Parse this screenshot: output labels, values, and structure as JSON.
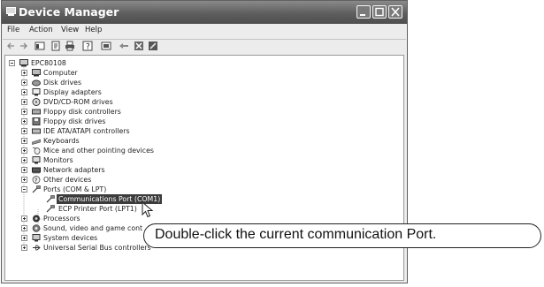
{
  "window": {
    "title": "Device Manager",
    "menu": [
      "File",
      "Action",
      "View",
      "Help"
    ]
  },
  "toolbar": {
    "icons": [
      "back-icon",
      "forward-icon",
      "view-icon",
      "properties-icon",
      "print-icon",
      "help-icon",
      "scan-icon",
      "update-driver-icon",
      "uninstall-icon",
      "disable-icon"
    ]
  },
  "tree": {
    "root": "EPC80108",
    "items": [
      {
        "label": "Computer",
        "expanded": false
      },
      {
        "label": "Disk drives",
        "expanded": false
      },
      {
        "label": "Display adapters",
        "expanded": false
      },
      {
        "label": "DVD/CD-ROM drives",
        "expanded": false
      },
      {
        "label": "Floppy disk controllers",
        "expanded": false
      },
      {
        "label": "Floppy disk drives",
        "expanded": false
      },
      {
        "label": "IDE ATA/ATAPI controllers",
        "expanded": false
      },
      {
        "label": "Keyboards",
        "expanded": false
      },
      {
        "label": "Mice and other pointing devices",
        "expanded": false
      },
      {
        "label": "Monitors",
        "expanded": false
      },
      {
        "label": "Network adapters",
        "expanded": false
      },
      {
        "label": "Other devices",
        "expanded": false
      },
      {
        "label": "Ports (COM & LPT)",
        "expanded": true
      },
      {
        "label": "Communications Port (COM1)",
        "child": true,
        "selected": true
      },
      {
        "label": "ECP Printer Port (LPT1)",
        "child": true
      },
      {
        "label": "Processors",
        "expanded": false
      },
      {
        "label": "Sound, video and game cont",
        "expanded": false
      },
      {
        "label": "System devices",
        "expanded": false
      },
      {
        "label": "Universal Serial Bus controllers",
        "expanded": false
      }
    ]
  },
  "callout": {
    "text": "Double-click the current communication Port."
  },
  "colors": {
    "titlebar": "#5e5e5e",
    "selection": "#3c3c3c",
    "window_bg": "#ececec"
  }
}
